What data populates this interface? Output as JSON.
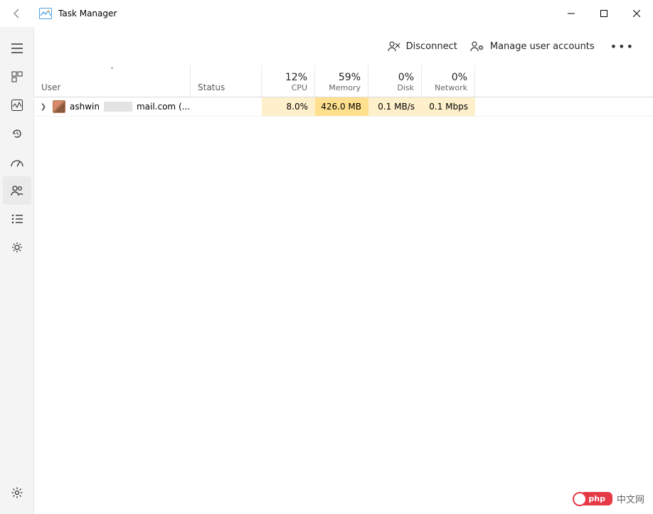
{
  "window": {
    "title": "Task Manager"
  },
  "toolbar": {
    "disconnect": "Disconnect",
    "manage_users": "Manage user accounts"
  },
  "columns": {
    "user": "User",
    "status": "Status",
    "cpu": {
      "value": "12%",
      "label": "CPU"
    },
    "memory": {
      "value": "59%",
      "label": "Memory"
    },
    "disk": {
      "value": "0%",
      "label": "Disk"
    },
    "network": {
      "value": "0%",
      "label": "Network"
    }
  },
  "rows": [
    {
      "user_prefix": "ashwin",
      "user_suffix": "mail.com (...",
      "status": "",
      "cpu": "8.0%",
      "memory": "426.0 MB",
      "disk": "0.1 MB/s",
      "network": "0.1 Mbps"
    }
  ],
  "watermark": {
    "badge": "php",
    "text": "中文网"
  }
}
